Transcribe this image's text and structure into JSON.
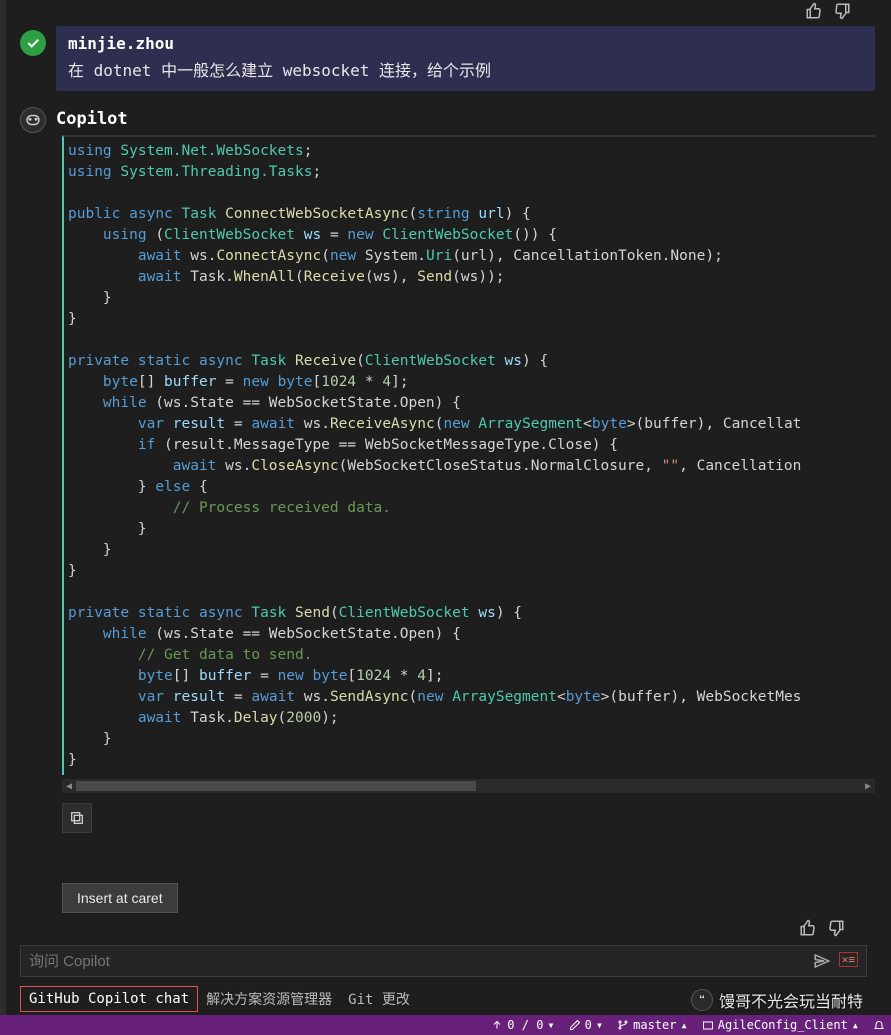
{
  "feedback": {
    "thumbs_up": "thumb-up",
    "thumbs_down": "thumb-down"
  },
  "user": {
    "name": "minjie.zhou",
    "message": "在 dotnet 中一般怎么建立 websocket 连接，给个示例"
  },
  "assistant": {
    "name": "Copilot"
  },
  "code": {
    "l1a": "using",
    "l1b": "System.Net.WebSockets",
    "l1c": ";",
    "l2a": "using",
    "l2b": "System.Threading.Tasks",
    "l2c": ";",
    "l4a": "public",
    "l4b": "async",
    "l4c": "Task",
    "l4d": "ConnectWebSocketAsync",
    "l4e": "(",
    "l4f": "string",
    "l4g": "url",
    "l4h": ") {",
    "l5a": "using",
    "l5b": "(",
    "l5c": "ClientWebSocket",
    "l5d": "ws",
    "l5e": "=",
    "l5f": "new",
    "l5g": "ClientWebSocket",
    "l5h": "()) {",
    "l6a": "await",
    "l6b": "ws.",
    "l6c": "ConnectAsync",
    "l6d": "(",
    "l6e": "new",
    "l6f": "System.",
    "l6g": "Uri",
    "l6h": "(url), CancellationToken.None);",
    "l7a": "await",
    "l7b": "Task.",
    "l7c": "WhenAll",
    "l7d": "(",
    "l7e": "Receive",
    "l7f": "(ws), ",
    "l7g": "Send",
    "l7h": "(ws));",
    "l8": "    }",
    "l9": "}",
    "l11a": "private",
    "l11b": "static",
    "l11c": "async",
    "l11d": "Task",
    "l11e": "Receive",
    "l11f": "(",
    "l11g": "ClientWebSocket",
    "l11h": "ws",
    "l11i": ") {",
    "l12a": "byte",
    "l12b": "[] ",
    "l12c": "buffer",
    "l12d": " = ",
    "l12e": "new",
    "l12f": "byte",
    "l12g": "[",
    "l12h": "1024",
    "l12i": " * ",
    "l12j": "4",
    "l12k": "];",
    "l13a": "while",
    "l13b": " (ws.State == WebSocketState.Open) {",
    "l14a": "var",
    "l14b": "result",
    "l14c": " = ",
    "l14d": "await",
    "l14e": " ws.",
    "l14f": "ReceiveAsync",
    "l14g": "(",
    "l14h": "new",
    "l14i": "ArraySegment",
    "l14j": "<",
    "l14k": "byte",
    "l14l": ">(buffer), Cancellat",
    "l15a": "if",
    "l15b": " (result.MessageType == WebSocketMessageType.Close) {",
    "l16a": "await",
    "l16b": " ws.",
    "l16c": "CloseAsync",
    "l16d": "(WebSocketCloseStatus.NormalClosure, ",
    "l16e": "\"\"",
    "l16f": ", Cancellation",
    "l17a": "} ",
    "l17b": "else",
    "l17c": " {",
    "l18": "// Process received data.",
    "l19": "        }",
    "l20": "    }",
    "l21": "}",
    "l23a": "private",
    "l23b": "static",
    "l23c": "async",
    "l23d": "Task",
    "l23e": "Send",
    "l23f": "(",
    "l23g": "ClientWebSocket",
    "l23h": "ws",
    "l23i": ") {",
    "l24a": "while",
    "l24b": " (ws.State == WebSocketState.Open) {",
    "l25": "// Get data to send.",
    "l26a": "byte",
    "l26b": "[] ",
    "l26c": "buffer",
    "l26d": " = ",
    "l26e": "new",
    "l26f": "byte",
    "l26g": "[",
    "l26h": "1024",
    "l26i": " * ",
    "l26j": "4",
    "l26k": "];",
    "l27a": "var",
    "l27b": "result",
    "l27c": " = ",
    "l27d": "await",
    "l27e": " ws.",
    "l27f": "SendAsync",
    "l27g": "(",
    "l27h": "new",
    "l27i": "ArraySegment",
    "l27j": "<",
    "l27k": "byte",
    "l27l": ">(buffer), WebSocketMes",
    "l28a": "await",
    "l28b": " Task.",
    "l28c": "Delay",
    "l28d": "(",
    "l28e": "2000",
    "l28f": ");",
    "l29": "    }",
    "l30": "}"
  },
  "buttons": {
    "insert_at_caret": "Insert at caret"
  },
  "input": {
    "placeholder": "询问 Copilot"
  },
  "tabs": {
    "copilot_chat": "GitHub Copilot chat",
    "solution_explorer": "解决方案资源管理器",
    "git_changes": "Git 更改"
  },
  "watermark": "馒哥不光会玩当耐特",
  "statusbar": {
    "errors": "0 / 0",
    "warnings": "0",
    "branch": "master",
    "project": "AgileConfig_Client"
  }
}
